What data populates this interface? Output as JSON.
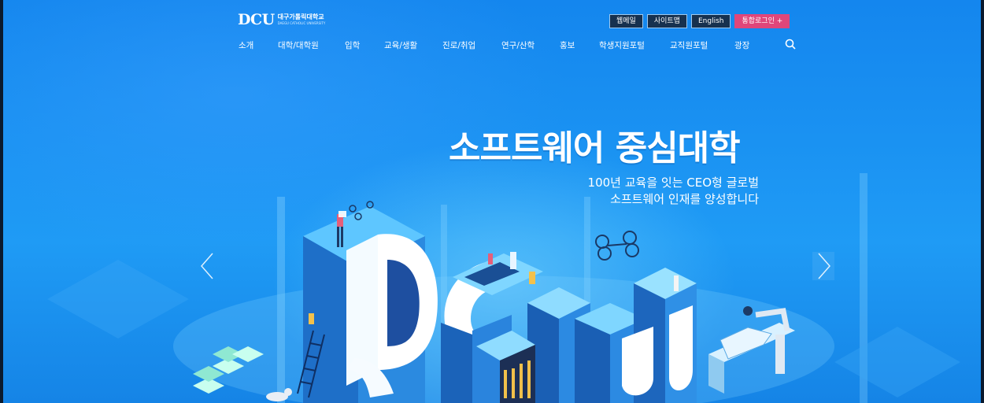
{
  "header": {
    "logo": {
      "mark": "DCU",
      "name_kr": "대구가톨릭대학교",
      "name_en": "DAEGU CATHOLIC UNIVERSITY"
    },
    "util": [
      {
        "label": "웹메일"
      },
      {
        "label": "사이트맵"
      },
      {
        "label": "English"
      },
      {
        "label": "통합로그인 +"
      }
    ],
    "nav": [
      {
        "label": "소개"
      },
      {
        "label": "대학/대학원"
      },
      {
        "label": "입학"
      },
      {
        "label": "교육/생활"
      },
      {
        "label": "진로/취업"
      },
      {
        "label": "연구/산학"
      },
      {
        "label": "홍보"
      },
      {
        "label": "학생지원포털"
      },
      {
        "label": "교직원포털"
      },
      {
        "label": "광장"
      }
    ],
    "search_icon": "search-icon"
  },
  "hero": {
    "headline": "소프트웨어 중심대학",
    "sub_line1": "100년 교육을 잇는 CEO형 글로벌",
    "sub_line2": "소프트웨어 인재를 양성합니다",
    "illustration_text": "DCU",
    "prev_icon": "chevron-left-icon",
    "next_icon": "chevron-right-icon"
  },
  "colors": {
    "accent": "#e0467a",
    "sky": "#1a92f2",
    "dark": "#17314f"
  }
}
